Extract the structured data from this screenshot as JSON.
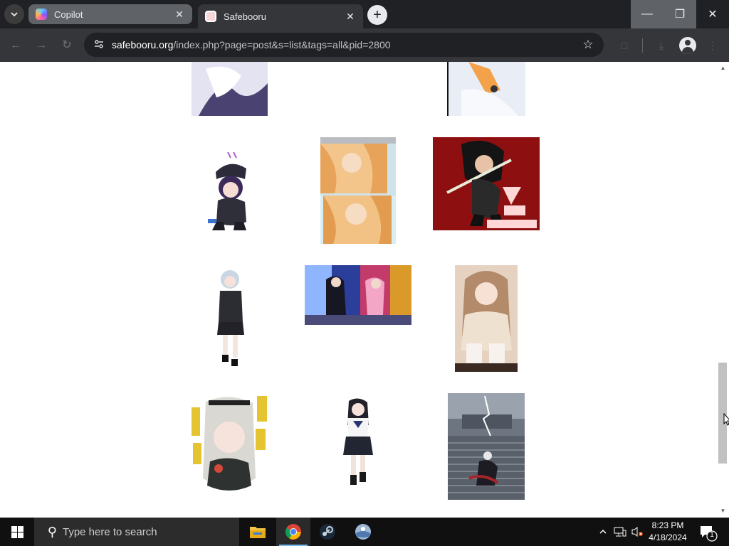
{
  "browser": {
    "tabs": [
      {
        "title": "Copilot",
        "active": false
      },
      {
        "title": "Safebooru",
        "active": true
      }
    ],
    "url_host": "safebooru.org",
    "url_path": "/index.php?page=post&s=list&tags=all&pid=2800",
    "icons": {
      "tab_search": "chevron-down",
      "new_tab": "+",
      "minimize": "—",
      "maximize": "❐",
      "close": "✕",
      "back": "←",
      "forward": "→",
      "reload": "↻",
      "site_info": "tune",
      "bookmark": "☆",
      "extensions": "□",
      "downloads": "⤓",
      "menu": "⋮"
    }
  },
  "page": {
    "background": "#ffffff",
    "thumbnails": [
      {
        "id": "post-1",
        "alt": "anime thumbnail (white dress, top cropped)"
      },
      {
        "id": "post-2",
        "alt": "anime thumbnail (white/orange, top cropped)"
      },
      {
        "id": "post-3",
        "alt": "anime thumbnail (chibi with black cap)"
      },
      {
        "id": "post-4",
        "alt": "anime thumbnail (orange-haired two-panel)"
      },
      {
        "id": "post-5",
        "alt": "anime thumbnail (red background 7th Dragon 2020)"
      },
      {
        "id": "post-6",
        "alt": "anime thumbnail (silver-haired girl in black)"
      },
      {
        "id": "post-7",
        "alt": "anime thumbnail (colorful scene with two girls)"
      },
      {
        "id": "post-8",
        "alt": "anime thumbnail (brown-haired girl sitting)"
      },
      {
        "id": "post-9",
        "alt": "anime thumbnail (white-haired girl with yellow text)"
      },
      {
        "id": "post-10",
        "alt": "anime thumbnail (schoolgirl in sailor uniform)"
      },
      {
        "id": "post-11",
        "alt": "anime thumbnail (figure on stone stairs)"
      }
    ]
  },
  "taskbar": {
    "search_placeholder": "Type here to search",
    "apps": [
      "file-explorer",
      "chrome",
      "steam",
      "misc-app"
    ],
    "time": "8:23 PM",
    "date": "4/18/2024",
    "notification_count": "1"
  },
  "colors": {
    "chrome_dark": "#202124",
    "chrome_toolbar": "#35363a",
    "taskbar": "#101010",
    "accent": "#76b9ed"
  }
}
